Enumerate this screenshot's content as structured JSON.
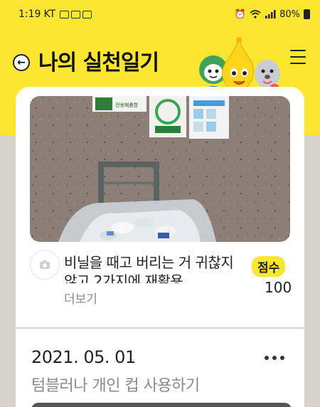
{
  "status_bar": {
    "time": "1:19",
    "carrier": "KT",
    "battery": "80%"
  },
  "header": {
    "title": "나의 실천일기"
  },
  "posts": [
    {
      "text": "비닐을 때고 버리는 거 귀찮지 않고 2가지에 재활용...",
      "more_label": "더보기",
      "score_label": "점수",
      "score": "100",
      "photo_sign_text": "전용폐품함"
    },
    {
      "date": "2021. 05. 01",
      "title": "텀블러나 개인 컵 사용하기"
    }
  ],
  "colors": {
    "brand_yellow": "#fde62f",
    "background_gray": "#d8d2cd"
  }
}
